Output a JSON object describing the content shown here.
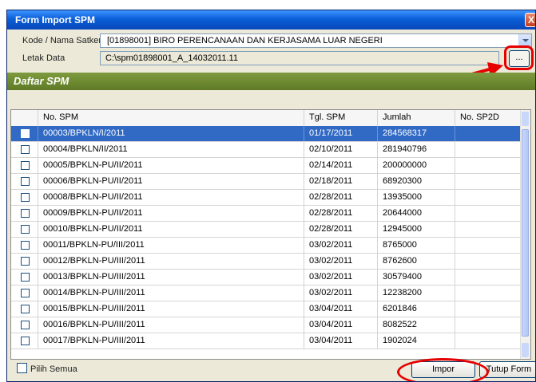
{
  "window": {
    "title": "Form Import SPM",
    "close_glyph": "X"
  },
  "form": {
    "kode_label": "Kode / Nama Satker",
    "kode_value": "[01898001] BIRO PERENCANAAN DAN KERJASAMA LUAR NEGERI",
    "letak_label": "Letak Data",
    "letak_value": "C:\\spm01898001_A_14032011.11",
    "browse_label": "..."
  },
  "section": {
    "title": "Daftar SPM"
  },
  "table": {
    "columns": [
      "No. SPM",
      "Tgl. SPM",
      "Jumlah",
      "No. SP2D"
    ],
    "rows": [
      {
        "no_spm": "00003/BPKLN/I/2011",
        "tgl": "01/17/2011",
        "jumlah": "284568317",
        "sp2d": "",
        "selected": true
      },
      {
        "no_spm": "00004/BPKLN/II/2011",
        "tgl": "02/10/2011",
        "jumlah": "281940796",
        "sp2d": ""
      },
      {
        "no_spm": "00005/BPKLN-PU/II/2011",
        "tgl": "02/14/2011",
        "jumlah": "200000000",
        "sp2d": ""
      },
      {
        "no_spm": "00006/BPKLN-PU/II/2011",
        "tgl": "02/18/2011",
        "jumlah": "68920300",
        "sp2d": ""
      },
      {
        "no_spm": "00008/BPKLN-PU/II/2011",
        "tgl": "02/28/2011",
        "jumlah": "13935000",
        "sp2d": ""
      },
      {
        "no_spm": "00009/BPKLN-PU/II/2011",
        "tgl": "02/28/2011",
        "jumlah": "20644000",
        "sp2d": ""
      },
      {
        "no_spm": "00010/BPKLN-PU/II/2011",
        "tgl": "02/28/2011",
        "jumlah": "12945000",
        "sp2d": ""
      },
      {
        "no_spm": "00011/BPKLN-PU/III/2011",
        "tgl": "03/02/2011",
        "jumlah": "8765000",
        "sp2d": ""
      },
      {
        "no_spm": "00012/BPKLN-PU/III/2011",
        "tgl": "03/02/2011",
        "jumlah": "8762600",
        "sp2d": ""
      },
      {
        "no_spm": "00013/BPKLN-PU/III/2011",
        "tgl": "03/02/2011",
        "jumlah": "30579400",
        "sp2d": ""
      },
      {
        "no_spm": "00014/BPKLN-PU/III/2011",
        "tgl": "03/02/2011",
        "jumlah": "12238200",
        "sp2d": ""
      },
      {
        "no_spm": "00015/BPKLN-PU/III/2011",
        "tgl": "03/04/2011",
        "jumlah": "6201846",
        "sp2d": ""
      },
      {
        "no_spm": "00016/BPKLN-PU/III/2011",
        "tgl": "03/04/2011",
        "jumlah": "8082522",
        "sp2d": ""
      },
      {
        "no_spm": "00017/BPKLN-PU/III/2011",
        "tgl": "03/04/2011",
        "jumlah": "1902024",
        "sp2d": ""
      }
    ]
  },
  "footer": {
    "select_all_label": "Pilih Semua",
    "impor_label": "Impor",
    "tutup_label": "Tutup Form"
  },
  "colors": {
    "title_bar": "#0a5fd8",
    "section_bar": "#6b8630",
    "selected_row": "#316ac5",
    "annotation_red": "#e60000"
  }
}
